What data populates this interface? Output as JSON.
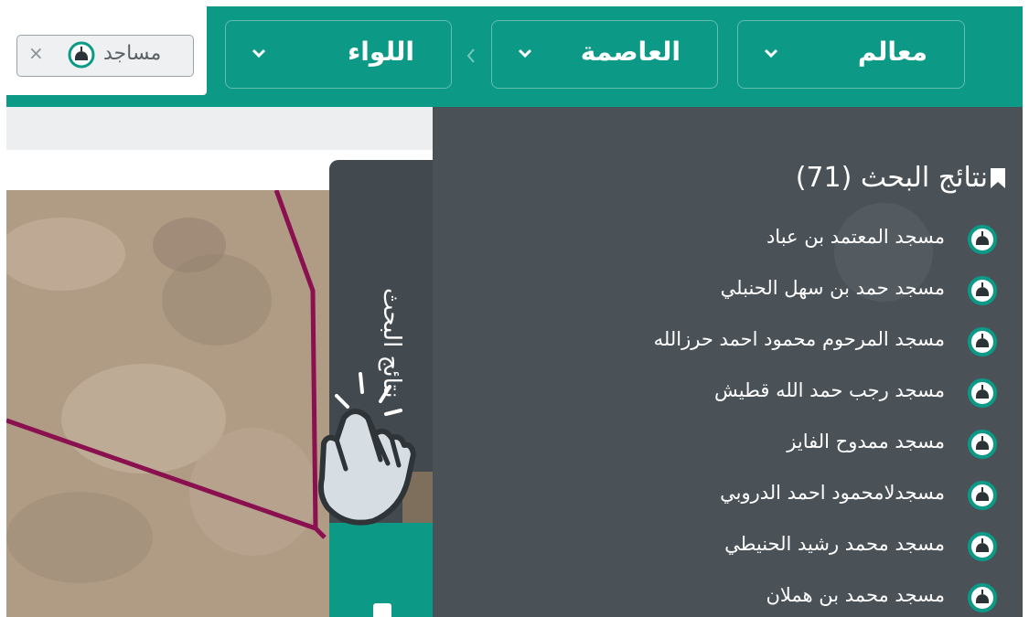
{
  "filters": {
    "landmarks": "معالم",
    "capital": "العاصمة",
    "district": "اللواء"
  },
  "tag": {
    "label": "مساجد",
    "remove": "×"
  },
  "side_tab": {
    "label": "نتائج البحث"
  },
  "results": {
    "title": "نتائج البحث (71)",
    "items": [
      "مسجد المعتمد بن عباد",
      "مسجد حمد بن سهل الحنبلي",
      "مسجد المرحوم محمود احمد حرزالله",
      "مسجد رجب حمد الله قطيش",
      "مسجد ممدوح الفايز",
      "مسجدلامحمود احمد الدروبي",
      "مسجد محمد رشيد الحنيطي",
      "مسجد محمد بن هملان"
    ]
  },
  "colors": {
    "brand_green": "#0c9a86",
    "panel_bg": "#4a5157",
    "map_boundary": "#8a1050"
  }
}
